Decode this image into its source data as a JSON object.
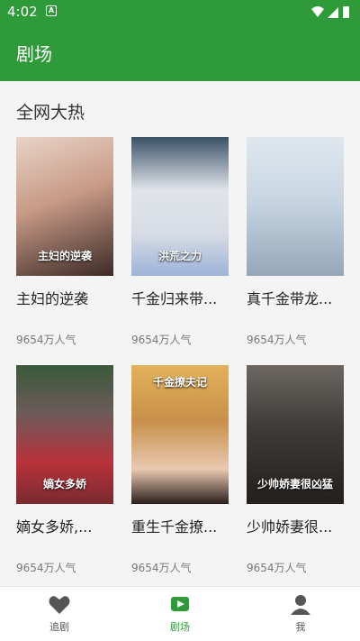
{
  "status_bar": {
    "time": "4:02",
    "notification_badge": "A"
  },
  "app_bar": {
    "title": "剧场"
  },
  "section": {
    "title": "全网大热"
  },
  "cards": [
    {
      "title": "主妇的逆袭",
      "popularity": "9654万人气",
      "poster_text": "主妇的逆袭"
    },
    {
      "title": "千金归来带...",
      "popularity": "9654万人气",
      "poster_text": "洪荒之力"
    },
    {
      "title": "真千金带龙...",
      "popularity": "9654万人气",
      "poster_text": ""
    },
    {
      "title": "嫡女多娇,...",
      "popularity": "9654万人气",
      "poster_text": "嫡女多娇"
    },
    {
      "title": "重生千金撩...",
      "popularity": "9654万人气",
      "poster_text": "千金撩夫记"
    },
    {
      "title": "少帅娇妻很...",
      "popularity": "9654万人气",
      "poster_text": "少帅娇妻很凶猛"
    }
  ],
  "bottom_nav": {
    "items": [
      {
        "label": "追剧",
        "icon": "heart-icon",
        "active": false
      },
      {
        "label": "剧场",
        "icon": "theater-icon",
        "active": true
      },
      {
        "label": "我",
        "icon": "user-icon",
        "active": false
      }
    ]
  },
  "colors": {
    "primary": "#2e9a3a",
    "background": "#f4f4f4"
  }
}
